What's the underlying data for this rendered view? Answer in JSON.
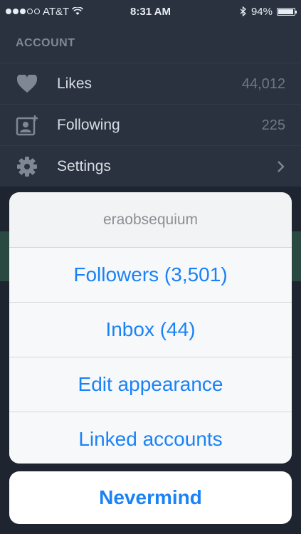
{
  "status_bar": {
    "carrier": "AT&T",
    "time": "8:31 AM",
    "battery": "94%",
    "battery_level": 0.94
  },
  "account": {
    "section_title": "ACCOUNT",
    "items": [
      {
        "label": "Likes",
        "value": "44,012",
        "icon": "heart-icon"
      },
      {
        "label": "Following",
        "value": "225",
        "icon": "add-person-icon"
      },
      {
        "label": "Settings",
        "value": "",
        "icon": "gear-icon"
      }
    ]
  },
  "action_sheet": {
    "title": "eraobsequium",
    "options": [
      "Followers (3,501)",
      "Inbox (44)",
      "Edit appearance",
      "Linked accounts"
    ],
    "cancel_label": "Nevermind"
  },
  "colors": {
    "accent": "#1a82f7",
    "background": "#2a3240"
  }
}
